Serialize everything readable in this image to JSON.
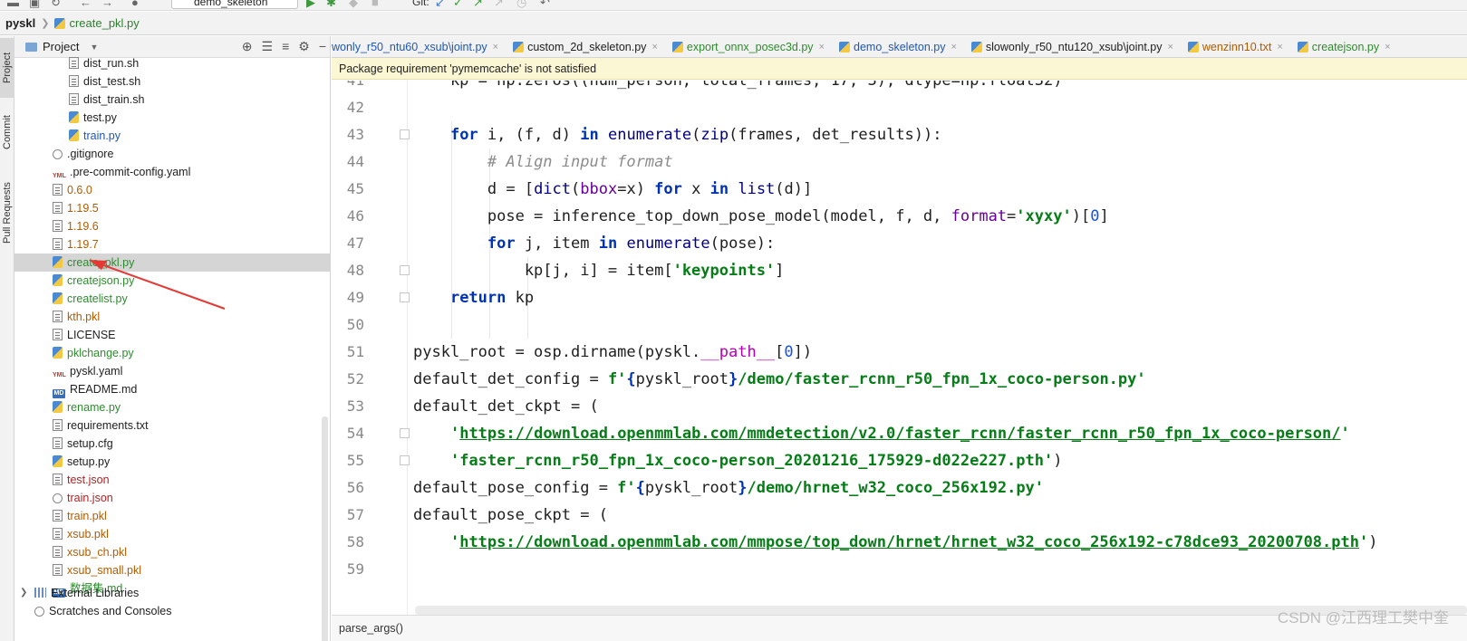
{
  "toolbar": {
    "run_config": "demo_skeleton",
    "git_label": "Git:"
  },
  "navbar": {
    "project": "pyskl",
    "file": "create_pkl.py"
  },
  "stripe": {
    "project": "Project",
    "commit": "Commit",
    "pull_requests": "Pull Requests"
  },
  "project_panel": {
    "title": "Project",
    "items": [
      {
        "label": "dist_run.sh",
        "type": "txt",
        "color": "def",
        "indent": 60
      },
      {
        "label": "dist_test.sh",
        "type": "txt",
        "color": "def",
        "indent": 60
      },
      {
        "label": "dist_train.sh",
        "type": "txt",
        "color": "def",
        "indent": 60
      },
      {
        "label": "test.py",
        "type": "py",
        "color": "def",
        "indent": 60
      },
      {
        "label": "train.py",
        "type": "py",
        "color": "mod",
        "indent": 60
      },
      {
        "label": ".gitignore",
        "type": "git",
        "color": "def",
        "indent": 42
      },
      {
        "label": ".pre-commit-config.yaml",
        "type": "yml",
        "color": "def",
        "indent": 42
      },
      {
        "label": "0.6.0",
        "type": "txt",
        "color": "ign",
        "indent": 42
      },
      {
        "label": "1.19.5",
        "type": "txt",
        "color": "ign",
        "indent": 42
      },
      {
        "label": "1.19.6",
        "type": "txt",
        "color": "ign",
        "indent": 42
      },
      {
        "label": "1.19.7",
        "type": "txt",
        "color": "ign",
        "indent": 42
      },
      {
        "label": "create_pkl.py",
        "type": "py",
        "color": "new",
        "indent": 42,
        "selected": true
      },
      {
        "label": "createjson.py",
        "type": "py",
        "color": "new",
        "indent": 42
      },
      {
        "label": "createlist.py",
        "type": "py",
        "color": "new",
        "indent": 42
      },
      {
        "label": "kth.pkl",
        "type": "txt",
        "color": "ign",
        "indent": 42
      },
      {
        "label": "LICENSE",
        "type": "txt",
        "color": "def",
        "indent": 42
      },
      {
        "label": "pklchange.py",
        "type": "py",
        "color": "new",
        "indent": 42
      },
      {
        "label": "pyskl.yaml",
        "type": "yml",
        "color": "def",
        "indent": 42
      },
      {
        "label": "README.md",
        "type": "md",
        "color": "def",
        "indent": 42
      },
      {
        "label": "rename.py",
        "type": "py",
        "color": "new",
        "indent": 42
      },
      {
        "label": "requirements.txt",
        "type": "txt",
        "color": "def",
        "indent": 42
      },
      {
        "label": "setup.cfg",
        "type": "txt",
        "color": "def",
        "indent": 42
      },
      {
        "label": "setup.py",
        "type": "py",
        "color": "def",
        "indent": 42
      },
      {
        "label": "test.json",
        "type": "txt",
        "color": "red",
        "indent": 42
      },
      {
        "label": "train.json",
        "type": "git",
        "color": "red",
        "indent": 42
      },
      {
        "label": "train.pkl",
        "type": "txt",
        "color": "ign",
        "indent": 42
      },
      {
        "label": "xsub.pkl",
        "type": "txt",
        "color": "ign",
        "indent": 42
      },
      {
        "label": "xsub_ch.pkl",
        "type": "txt",
        "color": "ign",
        "indent": 42
      },
      {
        "label": "xsub_small.pkl",
        "type": "txt",
        "color": "ign",
        "indent": 42
      },
      {
        "label": "数据集.md",
        "type": "md",
        "color": "new",
        "indent": 42
      }
    ],
    "external_libraries": "External Libraries",
    "scratches": "Scratches and Consoles"
  },
  "tabs": [
    {
      "label": "wonly_r50_ntu60_xsub\\joint.py",
      "color": "b"
    },
    {
      "label": "custom_2d_skeleton.py",
      "color": "def"
    },
    {
      "label": "export_onnx_posec3d.py",
      "color": "g"
    },
    {
      "label": "demo_skeleton.py",
      "color": "b"
    },
    {
      "label": "slowonly_r50_ntu120_xsub\\joint.py",
      "color": "def"
    },
    {
      "label": "wenzinn10.txt",
      "color": "o"
    },
    {
      "label": "createjson.py",
      "color": "g"
    }
  ],
  "banner": "Package requirement 'pymemcache' is not satisfied",
  "code_lines": [
    {
      "n": "41",
      "html": "    kp = np.zeros((num_person, total_frames, 17, 3), dtype=np.float32)"
    },
    {
      "n": "42",
      "html": ""
    },
    {
      "n": "43",
      "html": "    <span class='kw'>for</span> i, (f, d) <span class='kw'>in</span> <span class='bi'>enumerate</span>(<span class='bi'>zip</span>(frames, det_results)):"
    },
    {
      "n": "44",
      "html": "        <span class='cm'># Align input format</span>"
    },
    {
      "n": "45",
      "html": "        d = [<span class='bi'>dict</span>(<span class='pm'>bbox</span>=x) <span class='kw'>for</span> x <span class='kw'>in</span> <span class='bi'>list</span>(d)]"
    },
    {
      "n": "46",
      "html": "        pose = inference_top_down_pose_model(model, f, d, <span class='pm'>format</span>=<span class='st'>'xyxy'</span>)[<span class='nm'>0</span>]"
    },
    {
      "n": "47",
      "html": "        <span class='kw'>for</span> j, item <span class='kw'>in</span> <span class='bi'>enumerate</span>(pose):"
    },
    {
      "n": "48",
      "html": "            kp[j, i] = item[<span class='st'>'keypoints'</span>]"
    },
    {
      "n": "49",
      "html": "    <span class='kw'>return</span> kp"
    },
    {
      "n": "50",
      "html": ""
    },
    {
      "n": "51",
      "html": "pyskl_root = osp.dirname(pyskl.<span class='dn'>__path__</span>[<span class='nm'>0</span>])"
    },
    {
      "n": "52",
      "html": "default_det_config = <span class='st'>f'</span><span class='kw'>{</span>pyskl_root<span class='kw'>}</span><span class='st'>/demo/faster_rcnn_r50_fpn_1x_coco-person.py'</span>"
    },
    {
      "n": "53",
      "html": "default_det_ckpt = ("
    },
    {
      "n": "54",
      "html": "    <span class='st'>'</span><span class='url'>https://download.openmmlab.com/mmdetection/v2.0/faster_rcnn/faster_rcnn_r50_fpn_1x_coco-person/</span><span class='st'>'</span>"
    },
    {
      "n": "55",
      "html": "    <span class='st'>'faster_rcnn_r50_fpn_1x_coco-person_20201216_175929-d022e227.pth'</span>)"
    },
    {
      "n": "56",
      "html": "default_pose_config = <span class='st'>f'</span><span class='kw'>{</span>pyskl_root<span class='kw'>}</span><span class='st'>/demo/hrnet_w32_coco_256x192.py'</span>"
    },
    {
      "n": "57",
      "html": "default_pose_ckpt = ("
    },
    {
      "n": "58",
      "html": "    <span class='st'>'</span><span class='url'>https://download.openmmlab.com/mmpose/top_down/hrnet/hrnet_w32_coco_256x192-c78dce93_20200708.pth</span><span class='st'>'</span>)"
    },
    {
      "n": "59",
      "html": ""
    }
  ],
  "breadcrumb": "parse_args()",
  "watermark": "CSDN @江西理工樊中奎"
}
